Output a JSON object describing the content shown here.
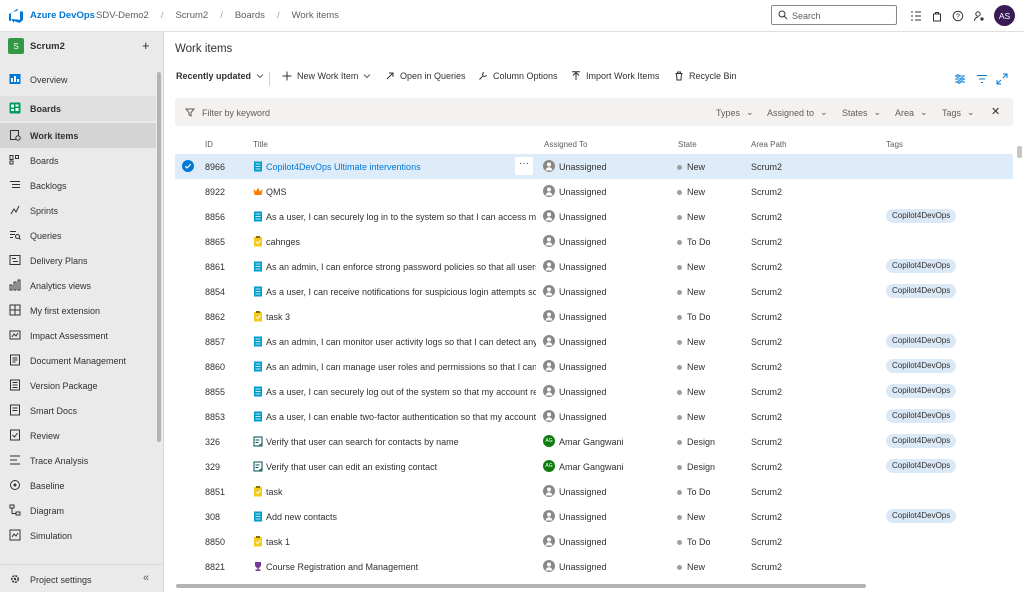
{
  "topbar": {
    "brand": "Azure DevOps",
    "breadcrumbs": [
      "SDV-Demo2",
      "Scrum2",
      "Boards",
      "Work items"
    ],
    "search_placeholder": "Search",
    "avatar_initials": "AS"
  },
  "sidebar": {
    "project_initial": "S",
    "project_name": "Scrum2",
    "items": [
      {
        "label": "Overview",
        "icon": "overview-icon"
      },
      {
        "label": "Boards",
        "icon": "boards-hub-icon"
      },
      {
        "label": "Work items",
        "icon": "work-items-icon"
      },
      {
        "label": "Boards",
        "icon": "kanban-board-icon"
      },
      {
        "label": "Backlogs",
        "icon": "backlogs-icon"
      },
      {
        "label": "Sprints",
        "icon": "sprints-icon"
      },
      {
        "label": "Queries",
        "icon": "queries-icon"
      },
      {
        "label": "Delivery Plans",
        "icon": "delivery-plans-icon"
      },
      {
        "label": "Analytics views",
        "icon": "analytics-icon"
      },
      {
        "label": "My first extension",
        "icon": "extension-icon"
      },
      {
        "label": "Impact Assessment",
        "icon": "impact-icon"
      },
      {
        "label": "Document Management",
        "icon": "document-icon"
      },
      {
        "label": "Version Package",
        "icon": "package-icon"
      },
      {
        "label": "Smart Docs",
        "icon": "smart-docs-icon"
      },
      {
        "label": "Review",
        "icon": "review-icon"
      },
      {
        "label": "Trace Analysis",
        "icon": "trace-icon"
      },
      {
        "label": "Baseline",
        "icon": "baseline-icon"
      },
      {
        "label": "Diagram",
        "icon": "diagram-icon"
      },
      {
        "label": "Simulation",
        "icon": "simulation-icon"
      }
    ],
    "settings_label": "Project settings"
  },
  "main": {
    "title": "Work items",
    "toolbar": {
      "view": "Recently updated",
      "new_item": "New Work Item",
      "open_queries": "Open in Queries",
      "column_options": "Column Options",
      "import": "Import Work Items",
      "recycle": "Recycle Bin"
    },
    "filter": {
      "placeholder": "Filter by keyword",
      "dropdowns": [
        "Types",
        "Assigned to",
        "States",
        "Area",
        "Tags"
      ]
    },
    "columns": [
      "ID",
      "Title",
      "Assigned To",
      "State",
      "Area Path",
      "Tags"
    ],
    "rows": [
      {
        "id": "8966",
        "type": "user-story",
        "title": "Copilot4DevOps Ultimate interventions",
        "assigned": "Unassigned",
        "state": "New",
        "area": "Scrum2",
        "tag": ""
      },
      {
        "id": "8922",
        "type": "epic",
        "title": "QMS",
        "assigned": "Unassigned",
        "state": "New",
        "area": "Scrum2",
        "tag": ""
      },
      {
        "id": "8856",
        "type": "user-story",
        "title": "As a user, I can securely log in to the system so that I can access my a",
        "assigned": "Unassigned",
        "state": "New",
        "area": "Scrum2",
        "tag": "Copilot4DevOps"
      },
      {
        "id": "8865",
        "type": "task",
        "title": "cahnges",
        "assigned": "Unassigned",
        "state": "To Do",
        "area": "Scrum2",
        "tag": ""
      },
      {
        "id": "8861",
        "type": "user-story",
        "title": "As an admin, I can enforce strong password policies so that all users m",
        "assigned": "Unassigned",
        "state": "New",
        "area": "Scrum2",
        "tag": "Copilot4DevOps"
      },
      {
        "id": "8854",
        "type": "user-story",
        "title": "As a user, I can receive notifications for suspicious login attempts so th",
        "assigned": "Unassigned",
        "state": "New",
        "area": "Scrum2",
        "tag": "Copilot4DevOps"
      },
      {
        "id": "8862",
        "type": "task",
        "title": "task 3",
        "assigned": "Unassigned",
        "state": "To Do",
        "area": "Scrum2",
        "tag": ""
      },
      {
        "id": "8857",
        "type": "user-story",
        "title": "As an admin, I can monitor user activity logs so that I can detect any u",
        "assigned": "Unassigned",
        "state": "New",
        "area": "Scrum2",
        "tag": "Copilot4DevOps"
      },
      {
        "id": "8860",
        "type": "user-story",
        "title": "As an admin, I can manage user roles and permissions so that I can cc",
        "assigned": "Unassigned",
        "state": "New",
        "area": "Scrum2",
        "tag": "Copilot4DevOps"
      },
      {
        "id": "8855",
        "type": "user-story",
        "title": "As a user, I can securely log out of the system so that my account rem",
        "assigned": "Unassigned",
        "state": "New",
        "area": "Scrum2",
        "tag": "Copilot4DevOps"
      },
      {
        "id": "8853",
        "type": "user-story",
        "title": "As a user, I can enable two-factor authentication so that my account h",
        "assigned": "Unassigned",
        "state": "New",
        "area": "Scrum2",
        "tag": "Copilot4DevOps"
      },
      {
        "id": "326",
        "type": "test-case",
        "title": "Verify that user can search for contacts by name",
        "assigned": "Amar Gangwani",
        "state": "Design",
        "area": "Scrum2",
        "tag": "Copilot4DevOps"
      },
      {
        "id": "329",
        "type": "test-case",
        "title": "Verify that user can edit an existing contact",
        "assigned": "Amar Gangwani",
        "state": "Design",
        "area": "Scrum2",
        "tag": "Copilot4DevOps"
      },
      {
        "id": "8851",
        "type": "task",
        "title": "task",
        "assigned": "Unassigned",
        "state": "To Do",
        "area": "Scrum2",
        "tag": ""
      },
      {
        "id": "308",
        "type": "user-story",
        "title": "Add new contacts",
        "assigned": "Unassigned",
        "state": "New",
        "area": "Scrum2",
        "tag": "Copilot4DevOps"
      },
      {
        "id": "8850",
        "type": "task",
        "title": "task 1",
        "assigned": "Unassigned",
        "state": "To Do",
        "area": "Scrum2",
        "tag": ""
      },
      {
        "id": "8821",
        "type": "feature",
        "title": "Course Registration and Management",
        "assigned": "Unassigned",
        "state": "New",
        "area": "Scrum2",
        "tag": ""
      }
    ]
  },
  "colors": {
    "accent": "#0078d4",
    "user_story": "#009ccc",
    "task": "#f2cb1d",
    "epic": "#ff7b00",
    "feature": "#773b93",
    "test_case": "#004b50",
    "selected_row": "#deecf9"
  }
}
